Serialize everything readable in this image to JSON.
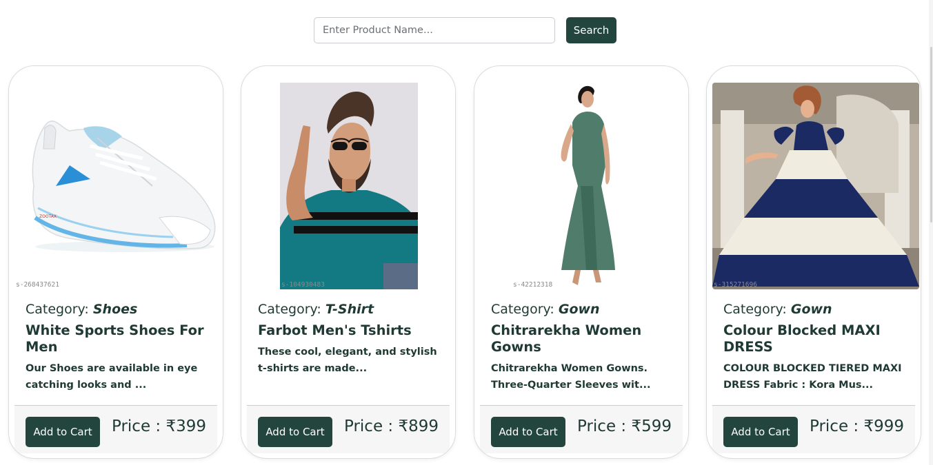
{
  "search": {
    "placeholder": "Enter Product Name...",
    "button_label": "Search"
  },
  "colors": {
    "primary": "#22463d",
    "text": "#1f3a34"
  },
  "products": [
    {
      "image_id": "s-268437621",
      "category_label": "Category: ",
      "category": "Shoes",
      "name": "White Sports Shoes For Men",
      "description": "Our Shoes are available in eye catching looks and ...",
      "add_label": "Add to Cart",
      "price": "Price : ₹399"
    },
    {
      "image_id": "s-104930483",
      "category_label": "Category: ",
      "category": "T-Shirt",
      "name": "Farbot Men's Tshirts",
      "description": "These cool, elegant, and stylish t-shirts are made...",
      "add_label": "Add to Cart",
      "price": "Price : ₹899"
    },
    {
      "image_id": "s-42212318",
      "category_label": "Category: ",
      "category": "Gown",
      "name": "Chitrarekha Women Gowns",
      "description": "Chitrarekha Women Gowns. Three-Quarter Sleeves wit...",
      "add_label": "Add to Cart",
      "price": "Price : ₹599"
    },
    {
      "image_id": "s-315271696",
      "category_label": "Category: ",
      "category": "Gown",
      "name": "Colour Blocked MAXI DRESS",
      "description": "COLOUR BLOCKED TIERED MAXI DRESS Fabric : Kora Mus...",
      "add_label": "Add to Cart",
      "price": "Price : ₹999"
    }
  ]
}
